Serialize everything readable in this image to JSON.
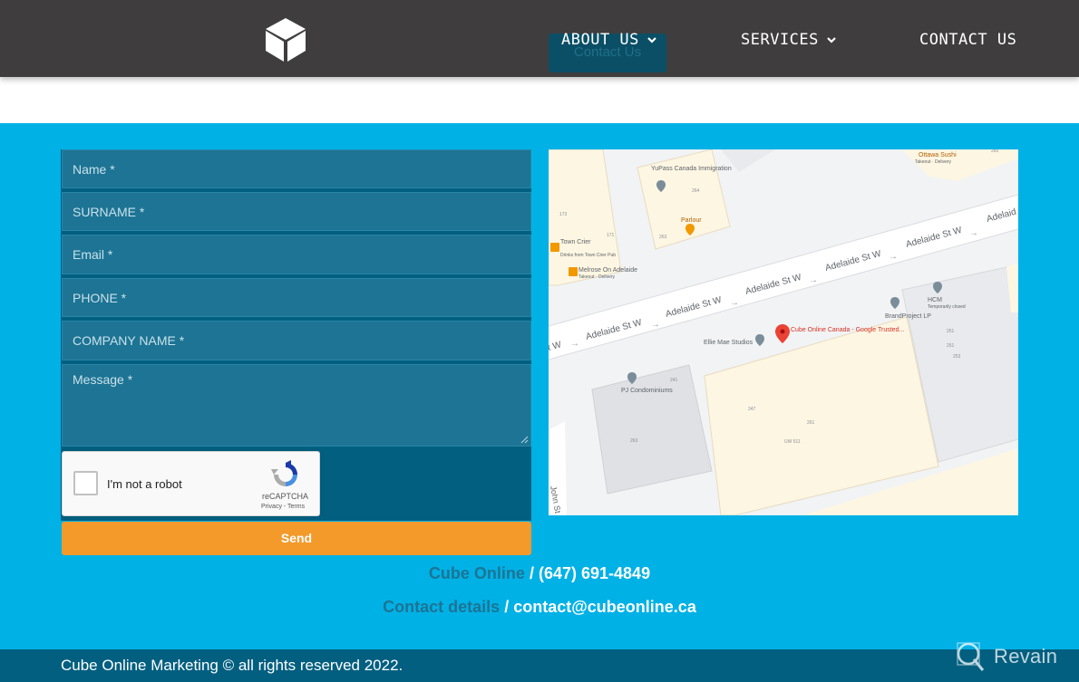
{
  "header": {
    "logo_icon": "cube-icon",
    "ghost_button_label": "Contact Us",
    "nav": [
      {
        "label": "ABOUT US",
        "has_dropdown": true
      },
      {
        "label": "SERVICES",
        "has_dropdown": true
      },
      {
        "label": "CONTACT US",
        "has_dropdown": false
      }
    ]
  },
  "form": {
    "fields": [
      {
        "placeholder": "Name *"
      },
      {
        "placeholder": "SURNAME *"
      },
      {
        "placeholder": "Email *"
      },
      {
        "placeholder": "PHONE *"
      },
      {
        "placeholder": "COMPANY NAME *"
      },
      {
        "placeholder": "Message *"
      }
    ],
    "captcha": {
      "label": "I'm not a robot",
      "brand": "reCAPTCHA",
      "terms": "Privacy - Terms"
    },
    "send_label": "Send"
  },
  "map": {
    "streets": [
      "Adelaide St W",
      "Adelaide St W",
      "Adelaide St W",
      "Adelaide St W",
      "Adelaide St W",
      "Adelaid",
      "t W",
      "John St"
    ],
    "places": [
      {
        "name": "YuPass Canada Immigration"
      },
      {
        "name": "Parlour"
      },
      {
        "name": "Town Crier",
        "sub": "Drinks from Town Crier Pub"
      },
      {
        "name": "Melrose On Adelaide",
        "sub": "Takeout · Delivery"
      },
      {
        "name": "Ottawa Sushi",
        "sub": "Takeout · Delivery"
      },
      {
        "name": "Cube Online Canada - Google Trusted..."
      },
      {
        "name": "Ellie Mae Studios"
      },
      {
        "name": "BrandProject LP"
      },
      {
        "name": "HCM",
        "sub": "Temporarily closed"
      },
      {
        "name": "PJ Condominiums"
      }
    ],
    "numbers": [
      "264",
      "173",
      "171",
      "263",
      "260",
      "261",
      "241",
      "247",
      "251",
      "UW 511",
      "263",
      "251",
      "253"
    ]
  },
  "contact": {
    "phone_label": "Cube Online",
    "phone_value": "(647) 691-4849",
    "email_label": "Contact details",
    "email_value": "contact@cubeonline.ca",
    "separator": "/"
  },
  "footer": {
    "copyright": "Cube Online Marketing © all rights reserved 2022.",
    "watermark": "Revain"
  },
  "colors": {
    "header_bg": "#403d3e",
    "section_bg": "#00b1e6",
    "form_bg": "#025f80",
    "field_bg": "#1d7494",
    "send_bg": "#f39a2b",
    "footer_bg": "#025f80",
    "map_pin": "#ea4335"
  }
}
